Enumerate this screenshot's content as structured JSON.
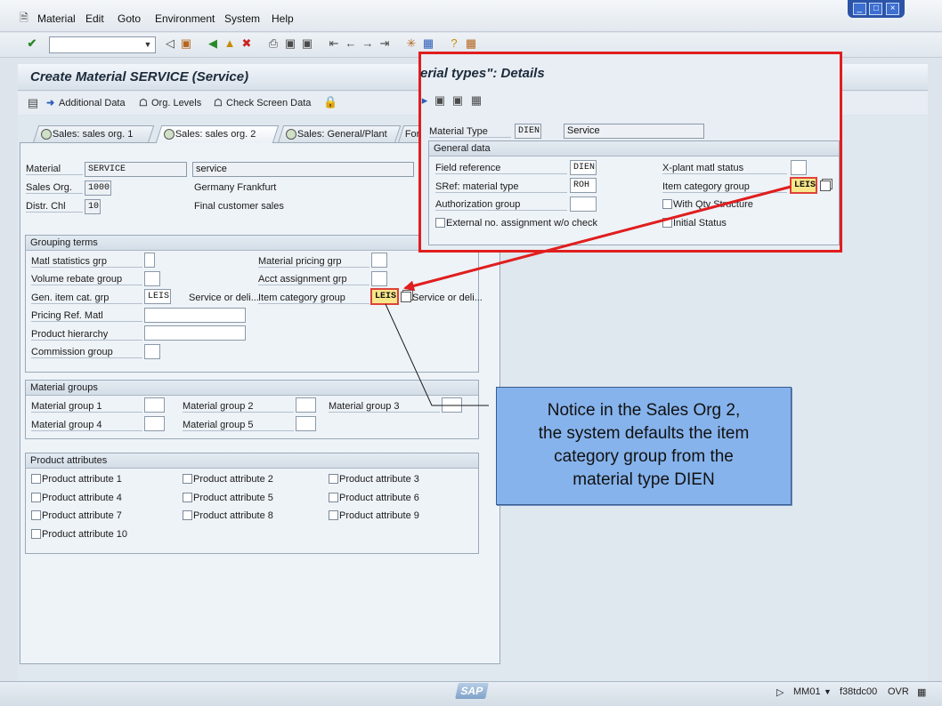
{
  "menu": {
    "items": [
      "Material",
      "Edit",
      "Goto",
      "Environment",
      "System",
      "Help"
    ]
  },
  "window_controls": [
    "_",
    "□",
    "×"
  ],
  "screen": {
    "title": "Create Material SERVICE (Service)",
    "toolbar": {
      "additional_data": "Additional Data",
      "org_levels": "Org. Levels",
      "check_screen_data": "Check Screen Data"
    },
    "tabs": [
      "Sales: sales org. 1",
      "Sales: sales org. 2",
      "Sales: General/Plant",
      "Fore"
    ],
    "header": {
      "material_label": "Material",
      "material_value": "SERVICE",
      "material_desc": "service",
      "sales_org_label": "Sales Org.",
      "sales_org_value": "1000",
      "sales_org_desc": "Germany Frankfurt",
      "distr_chl_label": "Distr. Chl",
      "distr_chl_value": "10",
      "distr_chl_desc": "Final customer sales"
    },
    "grouping_terms": {
      "title": "Grouping terms",
      "matl_statistics_grp": "Matl statistics grp",
      "volume_rebate_group": "Volume rebate group",
      "gen_item_cat_grp": "Gen. item cat. grp",
      "gen_item_cat_value": "LEIS",
      "gen_item_cat_desc": "Service or deli...",
      "pricing_ref_matl": "Pricing Ref. Matl",
      "product_hierarchy": "Product hierarchy",
      "commission_group": "Commission group",
      "material_pricing_grp": "Material pricing grp",
      "acct_assignment_grp": "Acct assignment grp",
      "item_category_group": "Item category group",
      "item_category_value": "LEIS",
      "item_category_desc": "Service or deli..."
    },
    "material_groups": {
      "title": "Material groups",
      "mg1": "Material group 1",
      "mg2": "Material group 2",
      "mg3": "Material group 3",
      "mg4": "Material group 4",
      "mg5": "Material group 5"
    },
    "product_attributes": {
      "title": "Product attributes",
      "items": [
        "Product attribute 1",
        "Product attribute 2",
        "Product attribute 3",
        "Product attribute 4",
        "Product attribute 5",
        "Product attribute 6",
        "Product attribute 7",
        "Product attribute 8",
        "Product attribute 9",
        "Product attribute 10"
      ]
    }
  },
  "popup": {
    "title": "erial types\": Details",
    "material_type_label": "Material Type",
    "material_type_value": "DIEN",
    "material_type_desc": "Service",
    "general_data_title": "General data",
    "field_reference_label": "Field reference",
    "field_reference_value": "DIEN",
    "sref_label": "SRef: material type",
    "sref_value": "ROH",
    "auth_group_label": "Authorization group",
    "external_no_label": "External no. assignment w/o check",
    "xplant_label": "X-plant matl status",
    "item_cat_label": "Item category group",
    "item_cat_value": "LEIS",
    "with_qty_label": "With Qty Structure",
    "initial_status_label": "Initial Status"
  },
  "callout": {
    "line1": "Notice in the Sales Org 2,",
    "line2": "the system defaults the item",
    "line3": "category group from the",
    "line4": "material type DIEN"
  },
  "statusbar": {
    "logo": "SAP",
    "transaction": "MM01",
    "server": "f38tdc00",
    "mode": "OVR"
  },
  "colors": {
    "highlight_border": "#e01e1e",
    "field_highlight": "#f7e78a",
    "callout_bg": "#86b3ec"
  }
}
